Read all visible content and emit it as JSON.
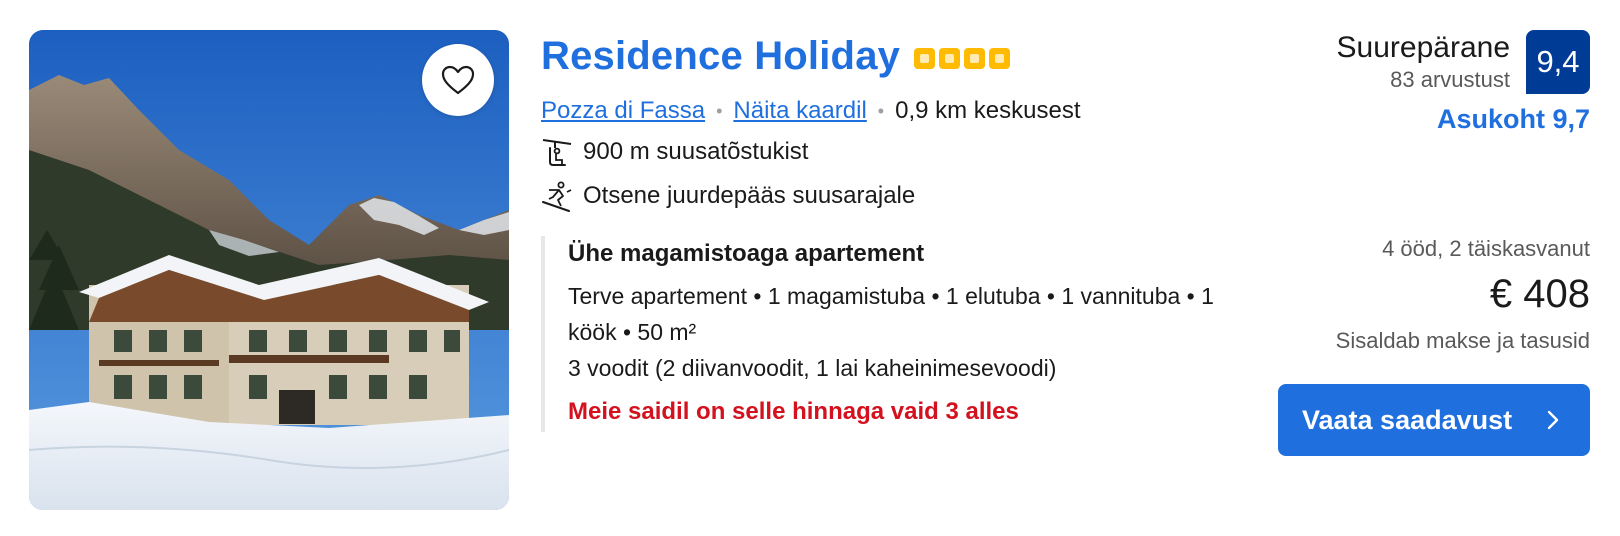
{
  "property": {
    "name": "Residence Holiday",
    "star_rating": 4,
    "location_link": "Pozza di Fassa",
    "map_link": "Näita kaardil",
    "distance": "0,9 km keskusest",
    "features": [
      {
        "icon": "ski-lift-icon",
        "text": "900 m suusatõstukist"
      },
      {
        "icon": "skier-icon",
        "text": "Otsene juurdepääs suusarajale"
      }
    ]
  },
  "room": {
    "title": "Ühe magamistoaga apartement",
    "description": "Terve apartement • 1 magamistuba • 1 elutuba • 1 vannituba • 1 köök • 50 m²",
    "beds": "3 voodit (2 diivanvoodit, 1 lai kaheinimesevoodi)",
    "availability": "Meie saidil on selle hinnaga vaid 3 alles"
  },
  "review": {
    "label": "Suurepärane",
    "count": "83 arvustust",
    "score": "9,4",
    "location_score": "Asukoht 9,7"
  },
  "pricing": {
    "stay": "4 ööd, 2 täiskasvanut",
    "price": "€ 408",
    "taxes": "Sisaldab makse ja tasusid",
    "cta_label": "Vaata saadavust"
  },
  "colors": {
    "link": "#1f6fde",
    "score_bg": "#003b95",
    "star": "#febb02",
    "urgency": "#d4111e",
    "cta_bg": "#1f6fde"
  },
  "icons": {
    "favorite": "heart-icon",
    "cta": "chevron-right-icon"
  }
}
